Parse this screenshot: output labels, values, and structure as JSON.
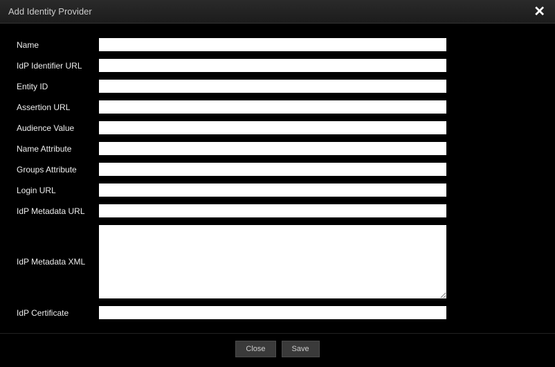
{
  "modal": {
    "title": "Add Identity Provider",
    "close_icon": "✕"
  },
  "form": {
    "name": {
      "label": "Name",
      "value": ""
    },
    "idp_identifier_url": {
      "label": "IdP Identifier URL",
      "value": ""
    },
    "entity_id": {
      "label": "Entity ID",
      "value": ""
    },
    "assertion_url": {
      "label": "Assertion URL",
      "value": ""
    },
    "audience_value": {
      "label": "Audience Value",
      "value": ""
    },
    "name_attribute": {
      "label": "Name Attribute",
      "value": ""
    },
    "groups_attribute": {
      "label": "Groups Attribute",
      "value": ""
    },
    "login_url": {
      "label": "Login URL",
      "value": ""
    },
    "idp_metadata_url": {
      "label": "IdP Metadata URL",
      "value": ""
    },
    "idp_metadata_xml": {
      "label": "IdP Metadata XML",
      "value": ""
    },
    "idp_certificate": {
      "label": "IdP Certificate",
      "value": ""
    }
  },
  "footer": {
    "close_label": "Close",
    "save_label": "Save"
  }
}
